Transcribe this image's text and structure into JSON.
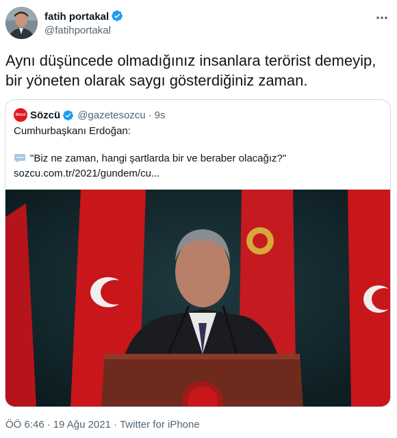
{
  "author": {
    "name": "fatih portakal",
    "handle": "@fatihportakal"
  },
  "tweet": {
    "text": "Aynı düşüncede olmadığınız insanlara terörist demeyip, bir yöneten olarak saygı gösterdiğiniz zaman."
  },
  "quote": {
    "logo_text": "Sözcü",
    "name": "Sözcü",
    "handle": "@gazetesozcu",
    "separator": "·",
    "time": "9s",
    "line1": "Cumhurbaşkanı Erdoğan:",
    "line2": "\"Biz ne zaman, hangi şartlarda bir ve beraber olacağız?\"",
    "link": "sozcu.com.tr/2021/gundem/cu..."
  },
  "meta": {
    "time": "ÖÖ 6:46",
    "separator": "·",
    "date": "19 Ağu 2021",
    "source": "Twitter for iPhone"
  },
  "colors": {
    "verified": "#1d9bf0",
    "secondary_text": "#536471",
    "border": "#cfd9de",
    "brand_red": "#e4171e"
  }
}
